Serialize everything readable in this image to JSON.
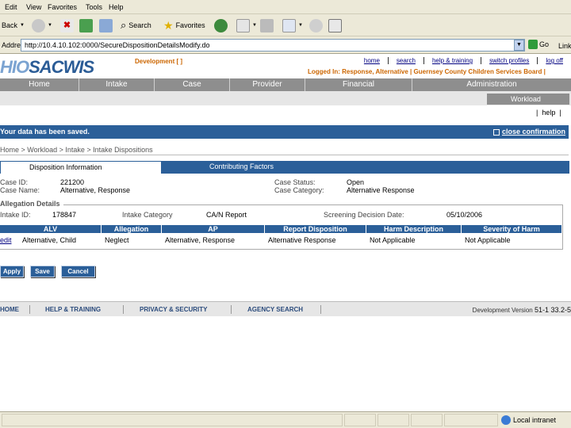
{
  "browser": {
    "menu": [
      "Edit",
      "View",
      "Favorites",
      "Tools",
      "Help"
    ],
    "toolbar": {
      "back": "Back",
      "search": "Search",
      "favorites": "Favorites"
    },
    "address_label": "Address",
    "address": "http://10.4.10.102:0000/SecureDispositionDetailsModify.do",
    "go_label": "Go",
    "links_label": "Links",
    "status_zone": "Local intranet"
  },
  "app": {
    "logo_prefix": "HIO",
    "logo_main": "SACWIS",
    "environment": "Development [ ]",
    "top_links": [
      "home",
      "search",
      "help & training",
      "switch profiles",
      "log off"
    ],
    "logged_in": "Logged In: Response, Alternative | Guernsey County Children Services Board |",
    "main_nav": [
      "Home",
      "Intake",
      "Case",
      "Provider",
      "Financial",
      "Administration"
    ],
    "sub_tab": "Workload",
    "help_link": "help"
  },
  "confirmation": {
    "message": "Your data has been saved.",
    "close_label": "close confirmation"
  },
  "breadcrumb": "Home > Workload > Intake > Intake Dispositions",
  "tabs": {
    "active": "Disposition Information",
    "inactive": "Contributing Factors"
  },
  "case": {
    "id_label": "Case ID:",
    "id_value": "221200",
    "name_label": "Case Name:",
    "name_value": "Alternative, Response",
    "status_label": "Case Status:",
    "status_value": "Open",
    "category_label": "Case Category:",
    "category_value": "Alternative Response"
  },
  "allegation": {
    "section_title": "Allegation Details",
    "intake_id_label": "Intake ID:",
    "intake_id_value": "178847",
    "category_label": "Intake Category",
    "category_value": "CA/N Report",
    "screening_label": "Screening Decision Date:",
    "screening_value": "05/10/2006",
    "columns": [
      "ALV",
      "Allegation",
      "AP",
      "Report Disposition",
      "Harm Description",
      "Severity of Harm"
    ],
    "rows": [
      {
        "edit": "edit",
        "alv": "Alternative, Child",
        "allegation": "Neglect",
        "ap": "Alternative, Response",
        "disposition": "Alternative Response",
        "harm": "Not Applicable",
        "severity": "Not Applicable"
      }
    ]
  },
  "buttons": {
    "apply": "Apply",
    "save": "Save",
    "cancel": "Cancel"
  },
  "footer": {
    "links": [
      "HOME",
      "HELP & TRAINING",
      "PRIVACY & SECURITY",
      "AGENCY SEARCH"
    ],
    "version_label": "Development Version",
    "version_value": "51-1 33.2-5"
  },
  "colors": {
    "brand_blue": "#2b5f99",
    "nav_gray": "#8e8e8e",
    "env_orange": "#cc6600"
  }
}
